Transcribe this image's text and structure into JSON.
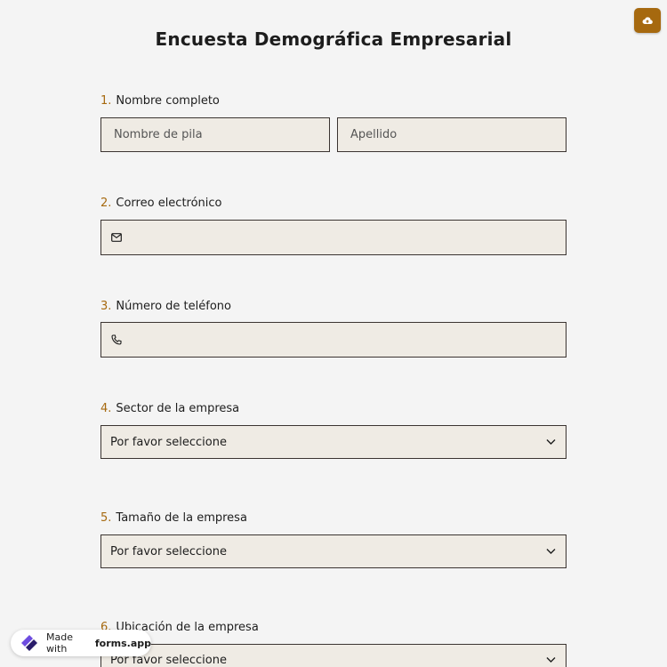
{
  "form": {
    "title": "Encuesta Demográfica Empresarial"
  },
  "questions": [
    {
      "num": "1.",
      "label": "Nombre completo",
      "first_placeholder": "Nombre de pila",
      "last_placeholder": "Apellido"
    },
    {
      "num": "2.",
      "label": "Correo electrónico",
      "icon": "envelope-icon"
    },
    {
      "num": "3.",
      "label": "Número de teléfono",
      "icon": "phone-icon"
    },
    {
      "num": "4.",
      "label": "Sector de la empresa",
      "selected": "Por favor seleccione"
    },
    {
      "num": "5.",
      "label": "Tamaño de la empresa",
      "selected": "Por favor seleccione"
    },
    {
      "num": "6.",
      "label": "Ubicación de la empresa",
      "selected": "Por favor seleccione"
    }
  ],
  "badge": {
    "prefix": "Made with",
    "brand": "forms.app"
  },
  "colors": {
    "accent": "#a6690f",
    "field_bg": "#efebe4",
    "field_border": "#3b3431",
    "page_bg": "#f4f4f4"
  }
}
